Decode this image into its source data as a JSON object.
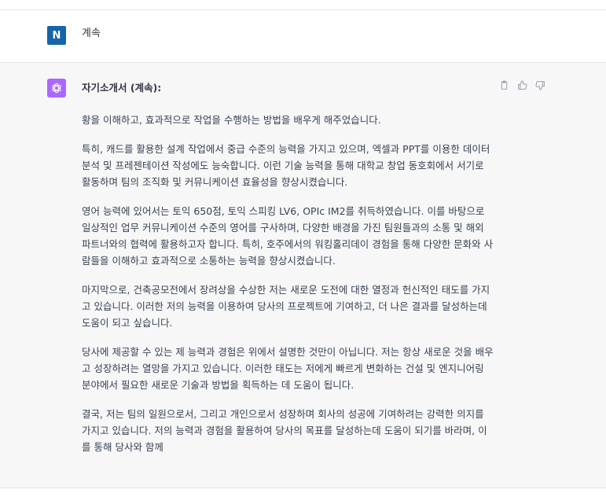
{
  "user_message": {
    "avatar_letter": "N",
    "text": "계속"
  },
  "assistant_message": {
    "title": "자기소개서 (계속):",
    "paragraphs": [
      "황을 이해하고, 효과적으로 작업을 수행하는 방법을 배우게 해주었습니다.",
      "특히, 캐드를 활용한 설계 작업에서 중급 수준의 능력을 가지고 있으며, 엑셀과 PPT를 이용한 데이터 분석 및 프레젠테이션 작성에도 능숙합니다. 이런 기술 능력을 통해 대학교 창업 동호회에서 서기로 활동하며 팀의 조직화 및 커뮤니케이션 효율성을 향상시켰습니다.",
      "영어 능력에 있어서는 토익 650점, 토익 스피킹 LV6, OPIc IM2를 취득하였습니다. 이를 바탕으로 일상적인 업무 커뮤니케이션 수준의 영어를 구사하며, 다양한 배경을 가진 팀원들과의 소통 및 해외 파트너와의 협력에 활용하고자 합니다. 특히, 호주에서의 워킹홀리데이 경험을 통해 다양한 문화와 사람들을 이해하고 효과적으로 소통하는 능력을 향상시켰습니다.",
      "마지막으로, 건축공모전에서 장려상을 수상한 저는 새로운 도전에 대한 열정과 헌신적인 태도를 가지고 있습니다. 이러한 저의 능력을 이용하여 당사의 프로젝트에 기여하고, 더 나은 결과를 달성하는데 도움이 되고 싶습니다.",
      "당사에 제공할 수 있는 제 능력과 경험은 위에서 설명한 것만이 아닙니다. 저는 항상 새로운 것을 배우고 성장하려는 열망을 가지고 있습니다. 이러한 태도는 저에게 빠르게 변화하는 건설 및 엔지니어링 분야에서 필요한 새로운 기술과 방법을 획득하는 데 도움이 됩니다.",
      "결국, 저는 팀의 일원으로서, 그리고 개인으로서 성장하며 회사의 성공에 기여하려는 강력한 의지를 가지고 있습니다. 저의 능력과 경험을 활용하여 당사의 목표를 달성하는데 도움이 되기를 바라며, 이를 통해 당사와 함께"
    ],
    "actions": [
      "copy-icon",
      "thumbs-up-icon",
      "thumbs-down-icon"
    ]
  },
  "colors": {
    "user_avatar_bg": "#1565a8",
    "bot_avatar_bg": "#ab68ff",
    "assistant_bg": "#f7f7f8"
  }
}
